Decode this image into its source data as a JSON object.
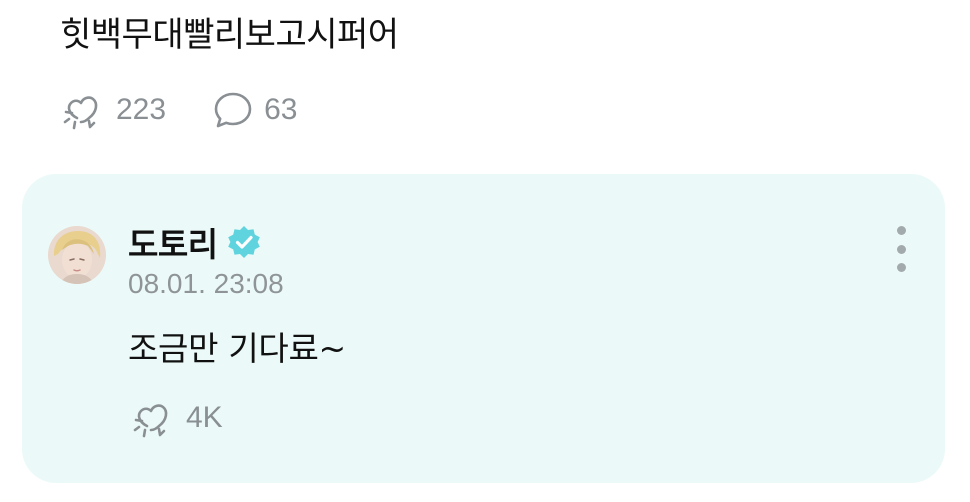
{
  "post": {
    "text": "힛백무대빨리보고시퍼어",
    "like_count": "223",
    "comment_count": "63"
  },
  "comment": {
    "author": "도토리",
    "timestamp": "08.01. 23:08",
    "text": "조금만 기다료~",
    "like_count": "4K"
  },
  "colors": {
    "card_background": "#ebfaf8",
    "verified_badge": "#5fd3de",
    "meta_text": "#8f9498"
  },
  "icons": {
    "like": "sparkle-heart-icon",
    "comment": "speech-bubble-icon",
    "verified": "verified-badge-icon",
    "more": "more-vertical-icon"
  }
}
